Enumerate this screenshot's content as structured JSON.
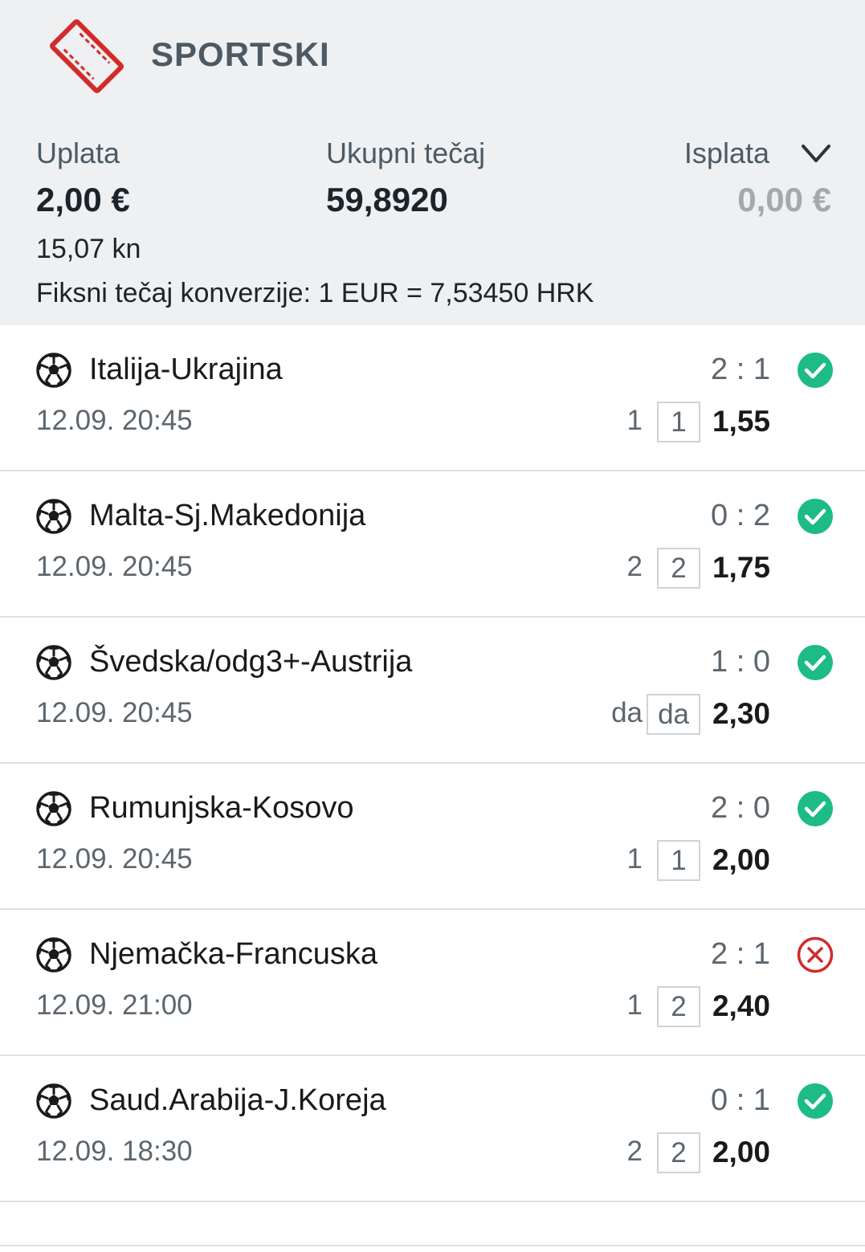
{
  "ticket": {
    "type_label": "SPORTSKI",
    "stake_label": "Uplata",
    "stake_value": "2,00 €",
    "total_odds_label": "Ukupni tečaj",
    "total_odds_value": "59,8920",
    "payout_label": "Isplata",
    "payout_value": "0,00 €",
    "stake_kn": "15,07 kn",
    "conversion_note": "Fiksni tečaj konverzije: 1 EUR = 7,53450 HRK"
  },
  "icons": {
    "ticket": "ticket-icon",
    "chevron": "chevron-down-icon",
    "sport": "soccer-ball-icon",
    "won": "check-circle-icon",
    "lost": "x-circle-icon"
  },
  "colors": {
    "won": "#1dbb85",
    "lost": "#d22b2b",
    "ticket_icon": "#d22b2b",
    "header_bg": "#eef0f2"
  },
  "matches": [
    {
      "name": "Italija-Ukrajina",
      "score": "2 : 1",
      "time": "12.09. 20:45",
      "pick": "1",
      "outcome": "1",
      "odds": "1,55",
      "status": "won"
    },
    {
      "name": "Malta-Sj.Makedonija",
      "score": "0 : 2",
      "time": "12.09. 20:45",
      "pick": "2",
      "outcome": "2",
      "odds": "1,75",
      "status": "won"
    },
    {
      "name": "Švedska/odg3+-Austrija",
      "score": "1 : 0",
      "time": "12.09. 20:45",
      "pick": "da",
      "outcome": "da",
      "odds": "2,30",
      "status": "won"
    },
    {
      "name": "Rumunjska-Kosovo",
      "score": "2 : 0",
      "time": "12.09. 20:45",
      "pick": "1",
      "outcome": "1",
      "odds": "2,00",
      "status": "won"
    },
    {
      "name": "Njemačka-Francuska",
      "score": "2 : 1",
      "time": "12.09. 21:00",
      "pick": "1",
      "outcome": "2",
      "odds": "2,40",
      "status": "lost"
    },
    {
      "name": "Saud.Arabija-J.Koreja",
      "score": "0 : 1",
      "time": "12.09. 18:30",
      "pick": "2",
      "outcome": "2",
      "odds": "2,00",
      "status": "won"
    }
  ]
}
